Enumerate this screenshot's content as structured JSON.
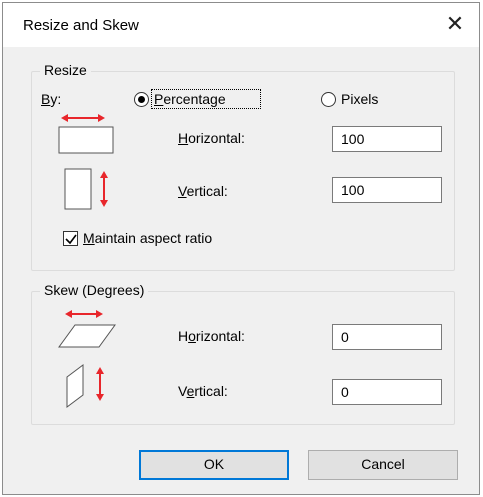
{
  "window": {
    "title": "Resize and Skew",
    "close_glyph": "✕"
  },
  "resize": {
    "group_label": "Resize",
    "by": {
      "prefix": "",
      "underlined": "B",
      "suffix": "y:"
    },
    "percentage": {
      "underlined": "P",
      "rest": "ercentage",
      "selected": true
    },
    "pixels": {
      "label": "Pixels",
      "selected": false
    },
    "horizontal": {
      "underlined": "H",
      "rest": "orizontal:",
      "value": "100"
    },
    "vertical": {
      "underlined": "V",
      "rest": "ertical:",
      "value": "100"
    },
    "maintain_aspect": {
      "underlined": "M",
      "rest": "aintain aspect ratio",
      "checked": true
    }
  },
  "skew": {
    "group_label": "Skew (Degrees)",
    "horizontal": {
      "prefix": "H",
      "underlined": "o",
      "rest": "rizontal:",
      "value": "0"
    },
    "vertical": {
      "prefix": "V",
      "underlined": "e",
      "rest": "rtical:",
      "value": "0"
    }
  },
  "buttons": {
    "ok": "OK",
    "cancel": "Cancel"
  },
  "colors": {
    "arrow": "#e8262b",
    "accent": "#0078d7"
  }
}
